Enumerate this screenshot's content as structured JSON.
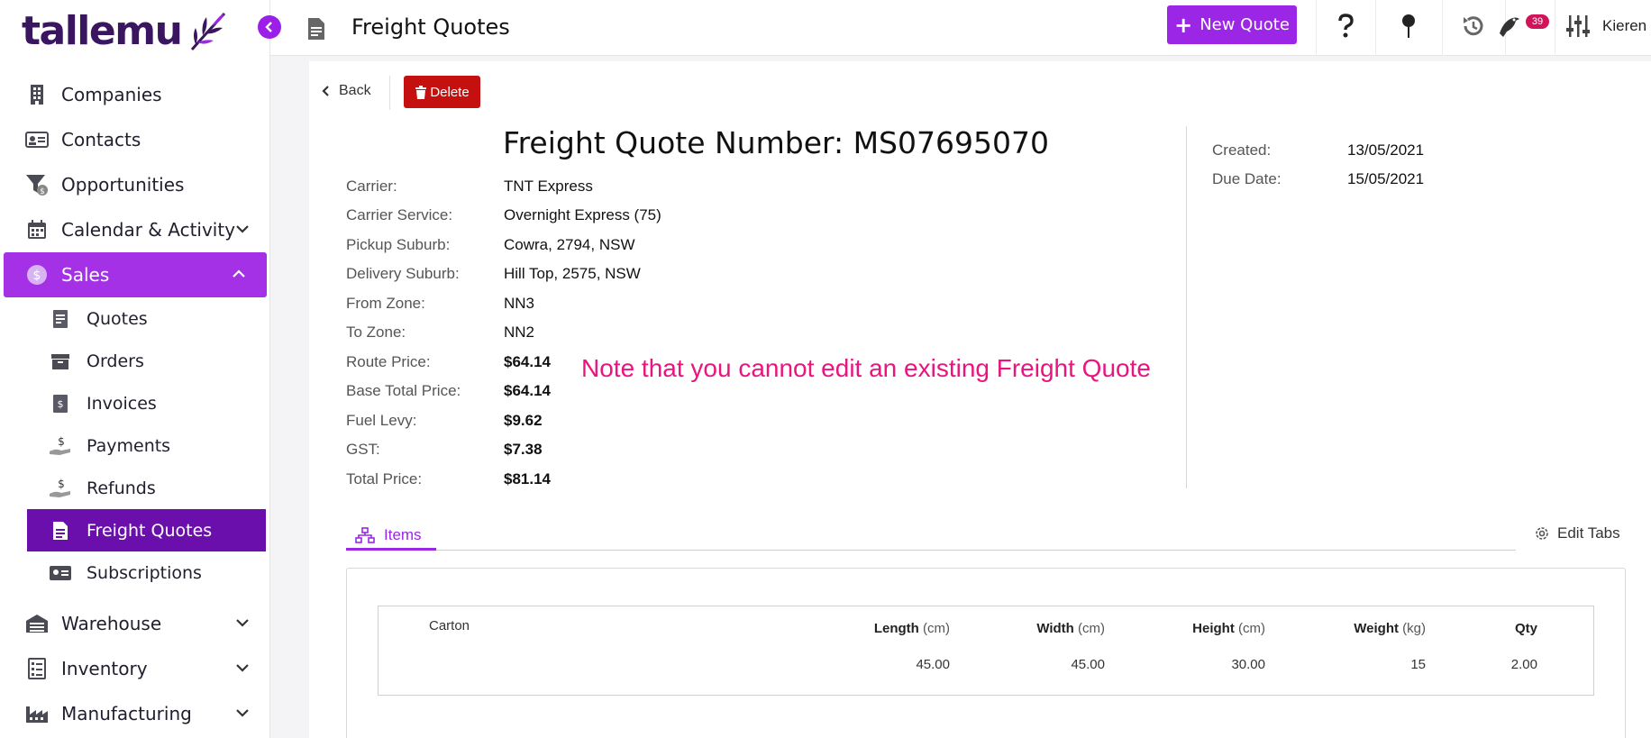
{
  "app": {
    "logo_text": "tallemu"
  },
  "sidebar": {
    "items": [
      {
        "label": "Companies",
        "icon": "building-icon"
      },
      {
        "label": "Contacts",
        "icon": "contact-card-icon"
      },
      {
        "label": "Opportunities",
        "icon": "funnel-icon"
      },
      {
        "label": "Calendar & Activity",
        "icon": "calendar-icon",
        "expandable": true
      },
      {
        "label": "Sales",
        "icon": "dollar-circle-icon",
        "expandable": true,
        "expanded": true,
        "active": true
      }
    ],
    "sales_sub": [
      {
        "label": "Quotes",
        "icon": "quote-doc-icon"
      },
      {
        "label": "Orders",
        "icon": "box-icon"
      },
      {
        "label": "Invoices",
        "icon": "invoice-icon"
      },
      {
        "label": "Payments",
        "icon": "payment-hand-icon"
      },
      {
        "label": "Refunds",
        "icon": "refund-hand-icon"
      },
      {
        "label": "Freight Quotes",
        "icon": "document-icon",
        "active": true
      },
      {
        "label": "Subscriptions",
        "icon": "subscription-card-icon"
      }
    ],
    "bottom_items": [
      {
        "label": "Warehouse",
        "icon": "warehouse-icon",
        "expandable": true
      },
      {
        "label": "Inventory",
        "icon": "checklist-icon",
        "expandable": true
      },
      {
        "label": "Manufacturing",
        "icon": "factory-icon",
        "expandable": true
      }
    ]
  },
  "header": {
    "title": "Freight Quotes",
    "new_button": "New Quote",
    "notifications_count": "39",
    "user_name": "Kieren"
  },
  "toolbar": {
    "back_label": "Back",
    "delete_label": "Delete"
  },
  "quote": {
    "title": "Freight Quote Number: MS07695070",
    "fields": [
      {
        "label": "Carrier:",
        "value": "TNT Express"
      },
      {
        "label": "Carrier Service:",
        "value": "Overnight Express (75)"
      },
      {
        "label": "Pickup Suburb:",
        "value": "Cowra, 2794, NSW"
      },
      {
        "label": "Delivery Suburb:",
        "value": "Hill Top, 2575, NSW"
      },
      {
        "label": "From Zone:",
        "value": "NN3"
      },
      {
        "label": "To Zone:",
        "value": "NN2"
      },
      {
        "label": "Route Price:",
        "value": "$64.14"
      },
      {
        "label": "Base Total Price:",
        "value": "$64.14"
      },
      {
        "label": "Fuel Levy:",
        "value": "$9.62"
      },
      {
        "label": "GST:",
        "value": "$7.38"
      },
      {
        "label": "Total Price:",
        "value": "$81.14"
      }
    ],
    "meta": [
      {
        "label": "Created:",
        "value": "13/05/2021"
      },
      {
        "label": "Due Date:",
        "value": "15/05/2021"
      }
    ],
    "note": "Note that you cannot edit an existing Freight Quote"
  },
  "tabs": {
    "items_label": "Items",
    "edit_tabs_label": "Edit Tabs"
  },
  "items_table": {
    "row_type": "Carton",
    "headers": [
      {
        "name": "Length",
        "unit": "(cm)"
      },
      {
        "name": "Width",
        "unit": "(cm)"
      },
      {
        "name": "Height",
        "unit": "(cm)"
      },
      {
        "name": "Weight",
        "unit": "(kg)"
      },
      {
        "name": "Qty",
        "unit": ""
      }
    ],
    "rows": [
      [
        "45.00",
        "45.00",
        "30.00",
        "15",
        "2.00"
      ]
    ]
  },
  "colors": {
    "accent": "#9b26e6",
    "active_nav": "#a431e6",
    "active_sub": "#6a0fab",
    "danger": "#c4110f",
    "note": "#e8157e",
    "brand": "#3a1560"
  }
}
